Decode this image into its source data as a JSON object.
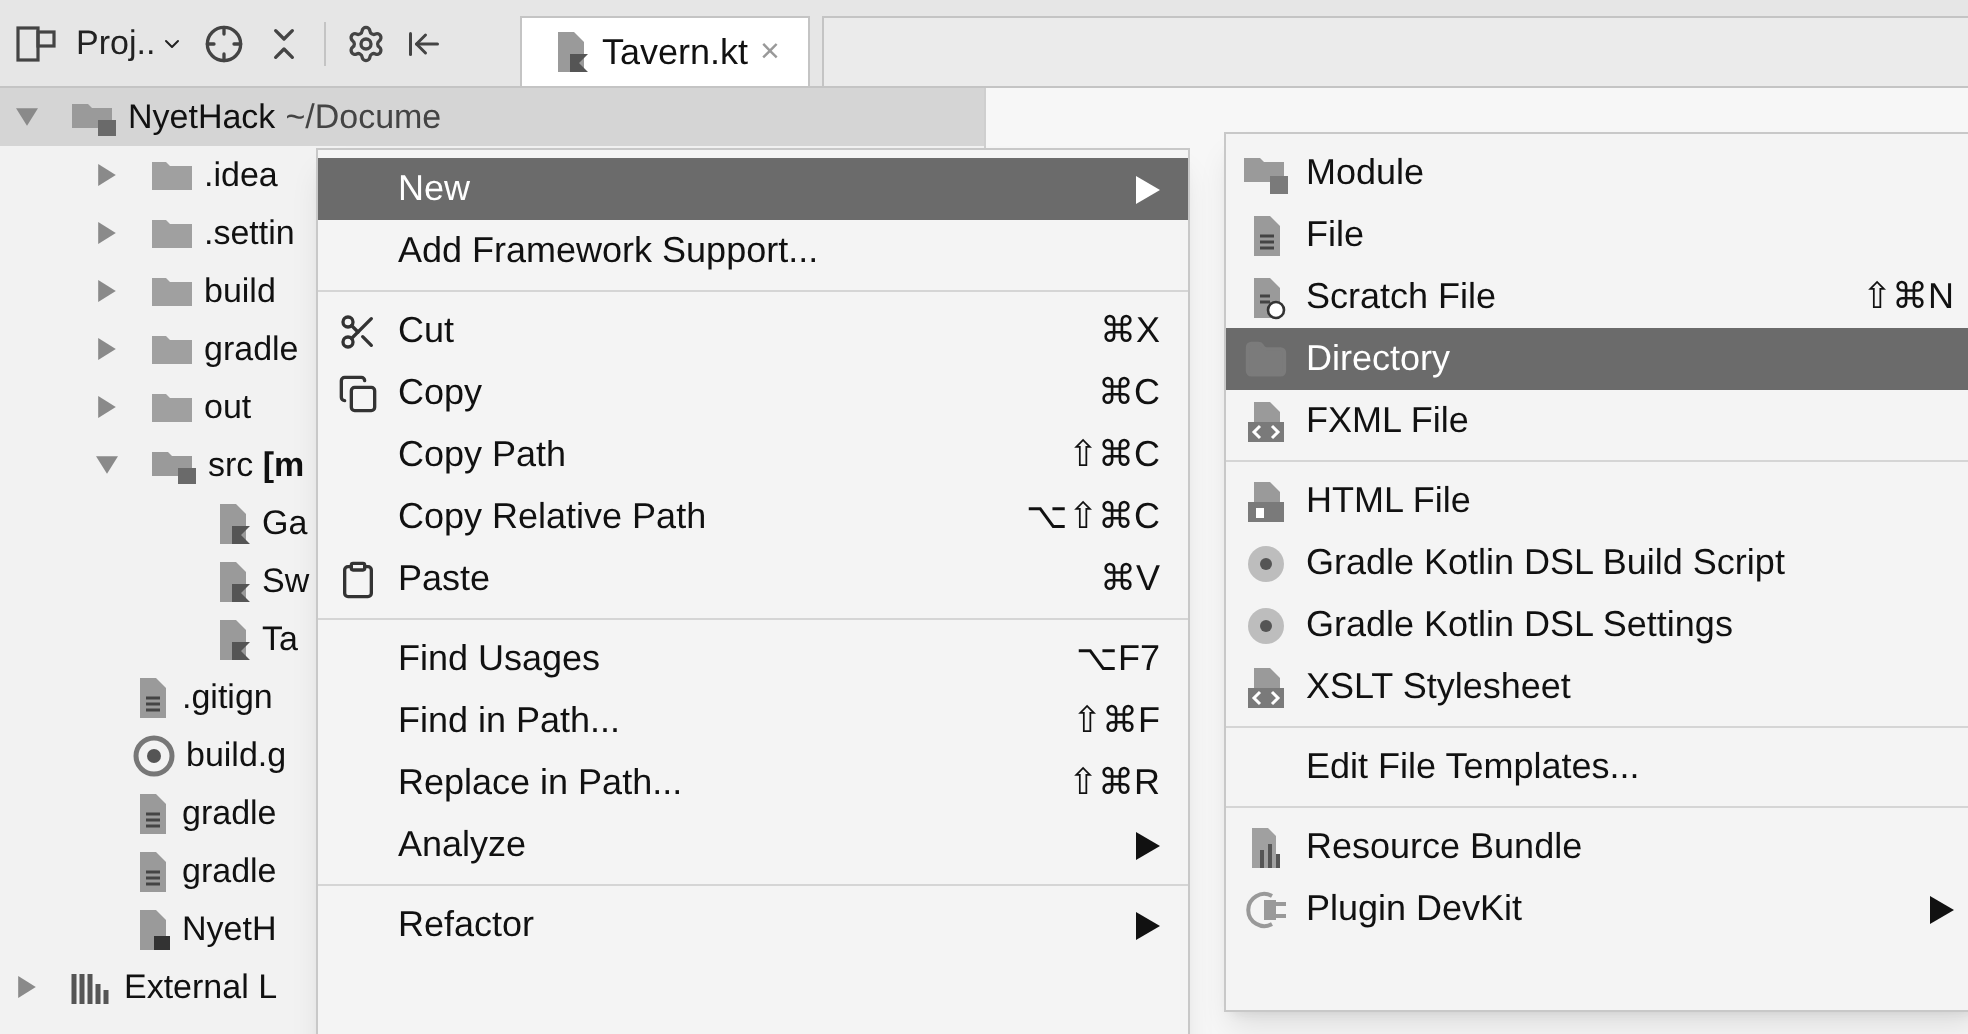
{
  "toolbar": {
    "project_label": "Proj..",
    "tab": {
      "label": "Tavern.kt",
      "close": "×",
      "selected": true
    }
  },
  "tree": [
    {
      "kind": "module",
      "label": "NyetHack",
      "path": "~/Docume",
      "expanded": true,
      "selected": true,
      "children": [
        {
          "kind": "folder",
          "label": ".idea",
          "expanded": false,
          "selected": false
        },
        {
          "kind": "folder",
          "label": ".settin",
          "expanded": false,
          "selected": false
        },
        {
          "kind": "folder",
          "label": "build",
          "expanded": false,
          "selected": false
        },
        {
          "kind": "folder",
          "label": "gradle",
          "expanded": false,
          "selected": false
        },
        {
          "kind": "folder",
          "label": "out",
          "expanded": false,
          "selected": false
        },
        {
          "kind": "source",
          "label": "src **[m**",
          "expanded": true,
          "selected": false,
          "children": [
            {
              "kind": "kotlin",
              "label": "Ga",
              "selected": false
            },
            {
              "kind": "kotlin",
              "label": "Sw",
              "selected": false
            },
            {
              "kind": "kotlin",
              "label": "Ta",
              "selected": false
            }
          ]
        },
        {
          "kind": "text",
          "label": ".gitign",
          "selected": false
        },
        {
          "kind": "gradle",
          "label": "build.g",
          "selected": false
        },
        {
          "kind": "text",
          "label": "gradle",
          "selected": false
        },
        {
          "kind": "text",
          "label": "gradle",
          "selected": false
        },
        {
          "kind": "iml",
          "label": "NyetH",
          "selected": false
        }
      ]
    },
    {
      "kind": "library",
      "label": "External L",
      "expanded": false,
      "selected": false
    }
  ],
  "context_menu": {
    "groups": [
      [
        {
          "label": "New",
          "submenu": true,
          "selected": true
        },
        {
          "label": "Add Framework Support...",
          "submenu": false,
          "selected": false
        }
      ],
      [
        {
          "label": "Cut",
          "kind": "cut",
          "shortcut": "⌘X",
          "submenu": false,
          "selected": false
        },
        {
          "label": "Copy",
          "kind": "copy",
          "shortcut": "⌘C",
          "submenu": false,
          "selected": false
        },
        {
          "label": "Copy Path",
          "shortcut": "⇧⌘C",
          "submenu": false,
          "selected": false
        },
        {
          "label": "Copy Relative Path",
          "shortcut": "⌥⇧⌘C",
          "submenu": false,
          "selected": false
        },
        {
          "label": "Paste",
          "kind": "paste",
          "shortcut": "⌘V",
          "submenu": false,
          "selected": false
        }
      ],
      [
        {
          "label": "Find Usages",
          "shortcut": "⌥F7",
          "submenu": false,
          "selected": false
        },
        {
          "label": "Find in Path...",
          "shortcut": "⇧⌘F",
          "submenu": false,
          "selected": false
        },
        {
          "label": "Replace in Path...",
          "shortcut": "⇧⌘R",
          "submenu": false,
          "selected": false
        },
        {
          "label": "Analyze",
          "submenu": true,
          "selected": false
        }
      ],
      [
        {
          "label": "Refactor",
          "submenu": true,
          "selected": false
        }
      ]
    ]
  },
  "new_submenu": {
    "groups": [
      [
        {
          "label": "Module",
          "kind": "module",
          "submenu": false,
          "selected": false
        },
        {
          "label": "File",
          "kind": "file",
          "submenu": false,
          "selected": false
        },
        {
          "label": "Scratch File",
          "kind": "scratch",
          "shortcut": "⇧⌘N",
          "submenu": false,
          "selected": false
        },
        {
          "label": "Directory",
          "kind": "folder",
          "submenu": false,
          "selected": true
        },
        {
          "label": "FXML File",
          "kind": "markup",
          "submenu": false,
          "selected": false
        }
      ],
      [
        {
          "label": "HTML File",
          "kind": "html",
          "submenu": false,
          "selected": false
        },
        {
          "label": "Gradle Kotlin DSL Build Script",
          "kind": "gradle",
          "submenu": false,
          "selected": false
        },
        {
          "label": "Gradle Kotlin DSL Settings",
          "kind": "gradle",
          "submenu": false,
          "selected": false
        },
        {
          "label": "XSLT Stylesheet",
          "kind": "markup",
          "submenu": false,
          "selected": false
        }
      ],
      [
        {
          "label": "Edit File Templates...",
          "submenu": false,
          "selected": false
        }
      ],
      [
        {
          "label": "Resource Bundle",
          "kind": "bundle",
          "submenu": false,
          "selected": false
        },
        {
          "label": "Plugin DevKit",
          "kind": "plugin",
          "submenu": true,
          "selected": false
        }
      ]
    ]
  }
}
